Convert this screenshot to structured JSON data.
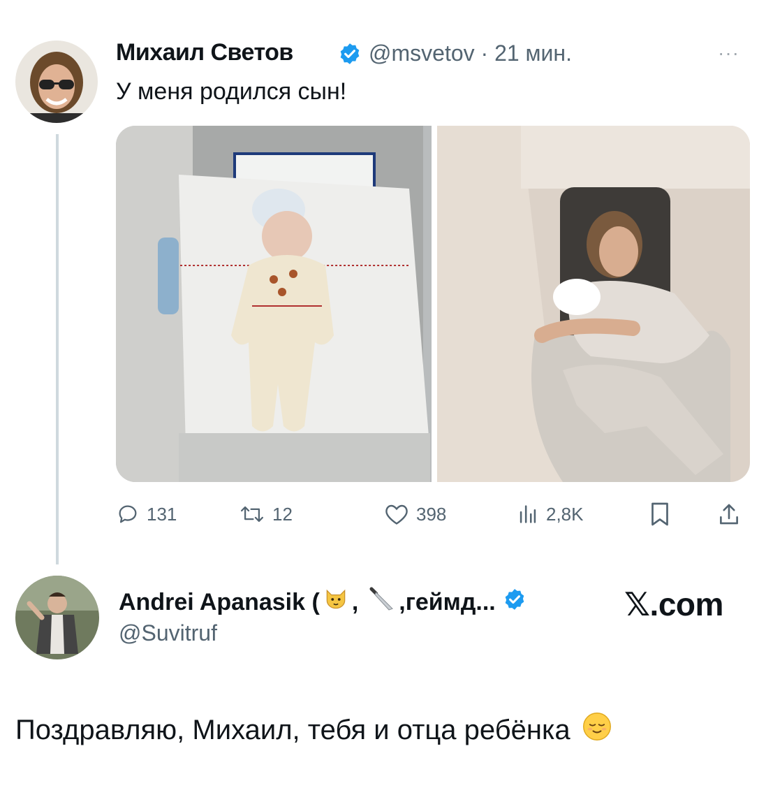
{
  "tweet": {
    "author_name": "Михаил Светов",
    "handle_time": "@msvetov · 21 мин.",
    "more_label": "···",
    "text": "У меня родился сын!",
    "media_icons": [
      "newborn-photo",
      "father-holding-baby-photo"
    ],
    "stats": {
      "replies": "131",
      "retweets": "12",
      "likes": "398",
      "views": "2,8K"
    }
  },
  "reply": {
    "author_name_start": "Andrei Apanasik (",
    "separator": ",",
    "author_name_end": ",геймд...",
    "handle": "@Suvitruf",
    "brand": "𝕏.com",
    "text": "Поздравляю, Михаил, тебя и отца ребёнка",
    "emojis": [
      "cat-face-emoji",
      "knife-emoji",
      "relieved-face-emoji"
    ]
  },
  "colors": {
    "verified": "#1d9bf0",
    "secondary_text": "#536471",
    "thread_line": "#cfd9de"
  }
}
